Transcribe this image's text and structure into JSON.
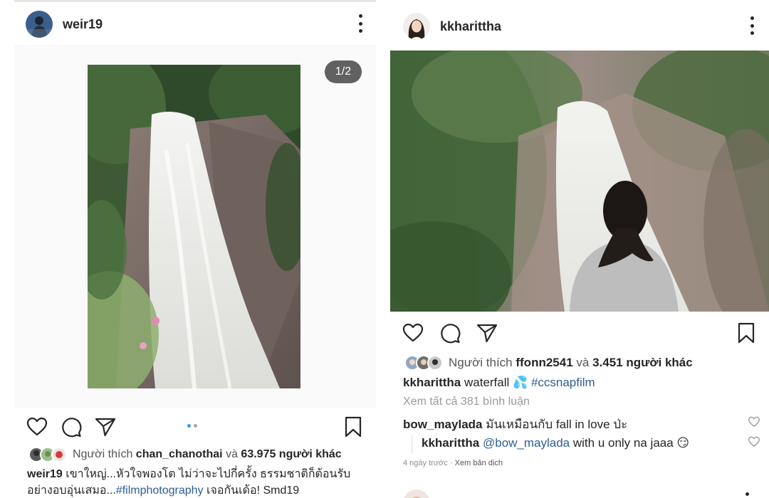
{
  "left_post": {
    "username": "weir19",
    "more_icon": "more-vertical-icon",
    "carousel_counter": "1/2",
    "carousel": {
      "count": 2,
      "active_index": 0,
      "active_color": "#3897f0",
      "inactive_color": "#a8a8a8"
    },
    "likes": {
      "prefix": "Người thích",
      "user": "chan_chanothai",
      "connector": "và",
      "others": "63.975 người khác"
    },
    "caption": {
      "username": "weir19",
      "text_line1": "เขาใหญ่...หัวใจพองโต ไม่ว่าจะไปกี่ครั้ง ธรรมชาติก็ต้อนรับ",
      "text_line2_start": "อย่างอบอุ่นเสมอ...",
      "hashtag": "#filmphotography",
      "text_line2_end": " เจอกันเด้อ! Smd19"
    }
  },
  "right_post": {
    "username": "kkharittha",
    "more_icon": "more-vertical-icon",
    "likes": {
      "prefix": "Người thích",
      "user": "ffonn2541",
      "connector": "và",
      "others": "3.451 người khác"
    },
    "caption": {
      "username": "kkharittha",
      "text": "waterfall",
      "emoji": "💦",
      "hashtag": "#ccsnapfilm"
    },
    "view_all_comments": "Xem tất cả 381 bình luận",
    "comments": [
      {
        "username": "bow_maylada",
        "text": "มันเหมือนกับ fall in love ป่ะ"
      },
      {
        "username": "kkharittha",
        "mention": "@bow_maylada",
        "text": " with u only na jaaa",
        "emoji": "😏"
      }
    ],
    "meta": {
      "time": "4 ngày trước",
      "separator": " · ",
      "translate": "Xem bản dịch"
    }
  },
  "icons": {
    "like": "heart-icon",
    "comment": "comment-icon",
    "share": "paper-plane-icon",
    "save": "bookmark-icon"
  },
  "colors": {
    "text": "#262626",
    "link": "#2c5e95",
    "muted": "#8e8e8e",
    "separator": "#efefef"
  }
}
